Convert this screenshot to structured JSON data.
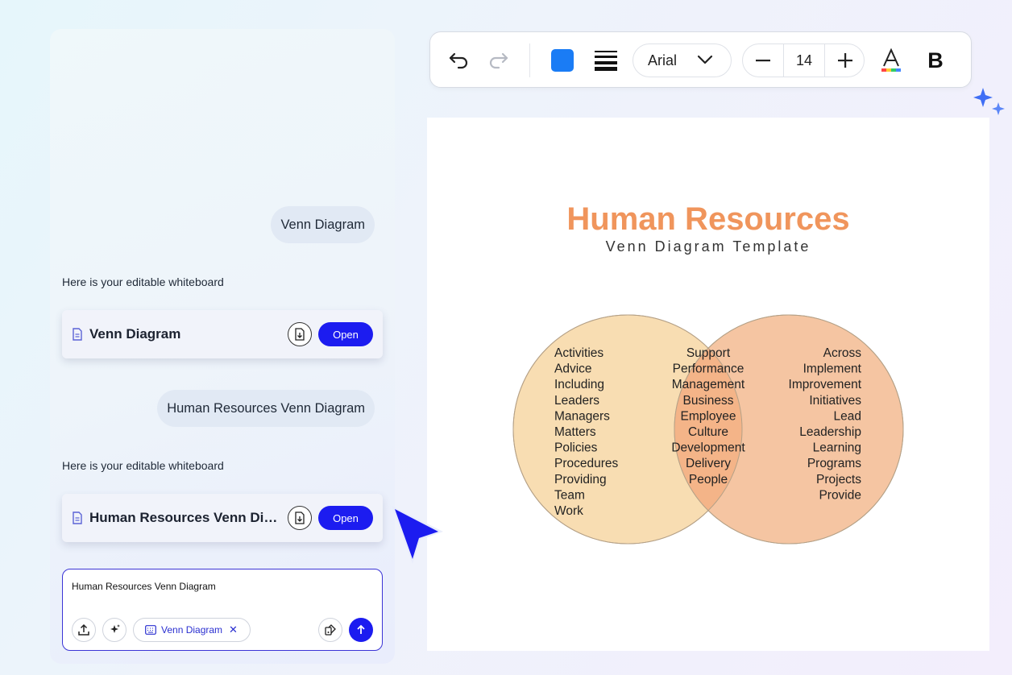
{
  "chat": {
    "messages": [
      {
        "role": "user",
        "text": "Venn Diagram"
      },
      {
        "role": "assistant",
        "text": "Here is your editable whiteboard"
      },
      {
        "role": "user",
        "text": "Human Resources Venn Diagram"
      },
      {
        "role": "assistant",
        "text": "Here is your editable whiteboard"
      }
    ],
    "files": [
      {
        "title": "Venn Diagram",
        "open_label": "Open"
      },
      {
        "title": "Human Resources Venn Diagram",
        "open_label": "Open"
      }
    ],
    "input": {
      "value": "Human Resources Venn Diagram",
      "chip_label": "Venn Diagram"
    }
  },
  "toolbar": {
    "fill_color": "#1a7cf5",
    "font_family": "Arial",
    "font_size": "14",
    "bold_label": "B",
    "text_color_label": "A",
    "icons": [
      "undo-icon",
      "redo-icon",
      "line-style-icon",
      "chevron-down-icon",
      "minus-icon",
      "plus-icon",
      "text-color-icon",
      "bold-icon"
    ]
  },
  "diagram": {
    "title": "Human Resources",
    "subtitle": "Venn Diagram Template",
    "colors": {
      "title": "#f0955c",
      "left_circle": "#f8ddb2",
      "right_circle": "#f5c5a2",
      "overlap": "#f4b488"
    },
    "left_items": [
      "Activities",
      "Advice",
      "Including",
      "Leaders",
      "Managers",
      "Matters",
      "Policies",
      "Procedures",
      "Providing",
      "Team",
      "Work"
    ],
    "center_items": [
      "Support",
      "Performance",
      "Management",
      "Business",
      "Employee",
      "Culture",
      "Development",
      "Delivery",
      "People"
    ],
    "right_items": [
      "Across",
      "Implement",
      "Improvement",
      "Initiatives",
      "Lead",
      "Leadership",
      "Learning",
      "Programs",
      "Projects",
      "Provide"
    ]
  }
}
